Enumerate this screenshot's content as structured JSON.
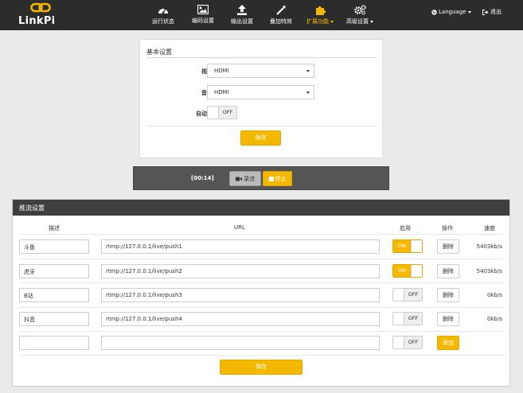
{
  "app": {
    "logo_text": "LinkPi"
  },
  "nav": {
    "items": [
      {
        "label": "运行状态",
        "icon": "dashboard-icon"
      },
      {
        "label": "编码设置",
        "icon": "image-icon"
      },
      {
        "label": "输出设置",
        "icon": "upload-icon"
      },
      {
        "label": "叠加特效",
        "icon": "magic-wand-icon"
      },
      {
        "label": "扩展功能",
        "icon": "puzzle-icon",
        "active": true,
        "dropdown": true
      },
      {
        "label": "高级设置",
        "icon": "gears-icon",
        "dropdown": true
      }
    ],
    "language": "Language",
    "logout": "退出"
  },
  "basic": {
    "title": "基本设置",
    "video_source_label": "视频源",
    "video_source_value": "HDMI",
    "audio_source_label": "音频源",
    "audio_source_value": "HDMI",
    "autorun_label": "自动运行",
    "autorun_state": "OFF",
    "save": "保存"
  },
  "record": {
    "time": "[00:14]",
    "record_label": "录流",
    "stop_label": "停止"
  },
  "push": {
    "title": "推流设置",
    "columns": {
      "desc": "描述",
      "url": "URL",
      "enable": "启用",
      "action": "操作",
      "speed": "速度"
    },
    "rows": [
      {
        "desc": "斗鱼",
        "url": "rtmp://127.0.0.1/live/push1",
        "enabled": "ON",
        "action": "删除",
        "speed": "5403kb/s"
      },
      {
        "desc": "虎牙",
        "url": "rtmp://127.0.0.1/live/push2",
        "enabled": "ON",
        "action": "删除",
        "speed": "5403kb/s"
      },
      {
        "desc": "B站",
        "url": "rtmp://127.0.0.1/live/push3",
        "enabled": "OFF",
        "action": "删除",
        "speed": "0kb/s"
      },
      {
        "desc": "抖音",
        "url": "rtmp://127.0.0.1/live/push4",
        "enabled": "OFF",
        "action": "删除",
        "speed": "0kb/s"
      }
    ],
    "new_row": {
      "desc": "",
      "url": "",
      "enabled": "OFF",
      "action": "添加"
    },
    "save": "保存"
  },
  "colors": {
    "accent": "#f5b800",
    "navbar": "#2c2c2c",
    "panel_header": "#3f3f3f"
  }
}
